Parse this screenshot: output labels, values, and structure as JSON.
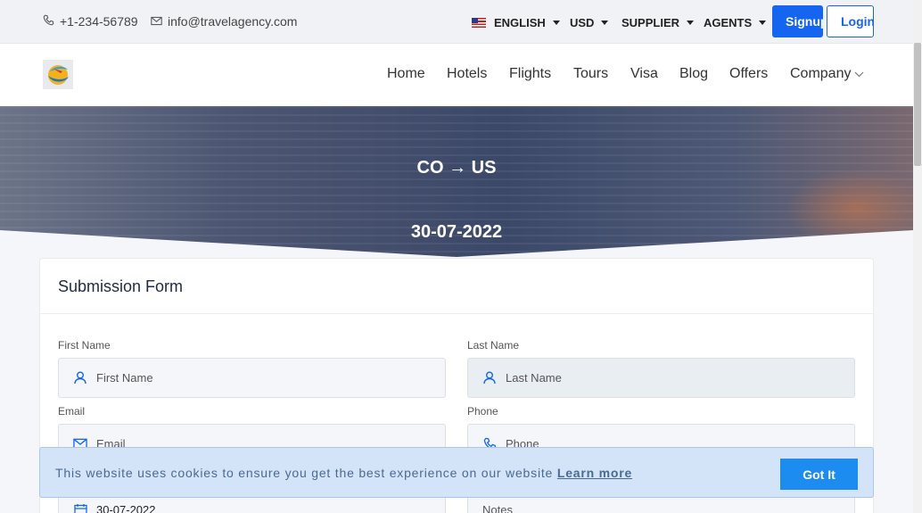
{
  "topbar": {
    "phone": "+1-234-56789",
    "email": "info@travelagency.com",
    "language": "ENGLISH",
    "currency": "USD",
    "supplier": "SUPPLIER",
    "agents": "AGENTS",
    "signup": "Signup",
    "login": "Login"
  },
  "nav": {
    "items": [
      "Home",
      "Hotels",
      "Flights",
      "Tours",
      "Visa",
      "Blog",
      "Offers",
      "Company"
    ]
  },
  "hero": {
    "from": "CO",
    "arrow": "→",
    "to": "US",
    "date": "30-07-2022"
  },
  "form": {
    "title": "Submission Form",
    "first_name_label": "First Name",
    "first_name_placeholder": "First Name",
    "last_name_label": "Last Name",
    "last_name_placeholder": "Last Name",
    "email_label": "Email",
    "email_placeholder": "Email",
    "phone_label": "Phone",
    "phone_placeholder": "Phone",
    "date_value": "30-07-2022",
    "notes_placeholder": "Notes"
  },
  "cookie": {
    "text": "This website uses cookies to ensure you get the best experience on our website",
    "link": "Learn more",
    "button": "Got It"
  },
  "colors": {
    "accent": "#1565f0",
    "cookie_bg": "#d4e4f8",
    "cookie_button": "#1c8cf0"
  }
}
